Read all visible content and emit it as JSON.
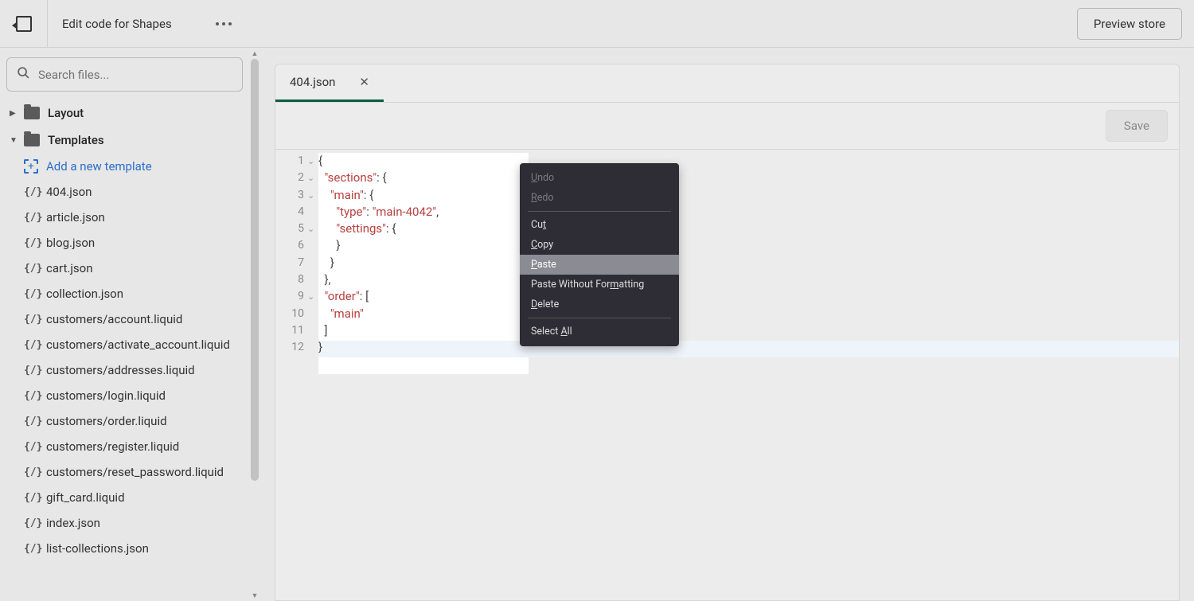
{
  "header": {
    "title": "Edit code for Shapes",
    "preview_label": "Preview store"
  },
  "search": {
    "placeholder": "Search files..."
  },
  "folders": {
    "layout": "Layout",
    "templates": "Templates"
  },
  "add_template": "Add a new template",
  "template_files": [
    "404.json",
    "article.json",
    "blog.json",
    "cart.json",
    "collection.json",
    "customers/account.liquid",
    "customers/activate_account.liquid",
    "customers/addresses.liquid",
    "customers/login.liquid",
    "customers/order.liquid",
    "customers/register.liquid",
    "customers/reset_password.liquid",
    "gift_card.liquid",
    "index.json",
    "list-collections.json"
  ],
  "tab": {
    "label": "404.json"
  },
  "toolbar": {
    "save_label": "Save"
  },
  "code": {
    "lines": [
      {
        "n": "1",
        "fold": "⌄",
        "pre": "",
        "str": "",
        "post": "{"
      },
      {
        "n": "2",
        "fold": "⌄",
        "pre": "  ",
        "str": "\"sections\"",
        "post": ": {"
      },
      {
        "n": "3",
        "fold": "⌄",
        "pre": "    ",
        "str": "\"main\"",
        "post": ": {"
      },
      {
        "n": "4",
        "fold": "",
        "pre": "      ",
        "str": "\"type\"",
        "mid": ": ",
        "str2": "\"main-4042\"",
        "post": ","
      },
      {
        "n": "5",
        "fold": "⌄",
        "pre": "      ",
        "str": "\"settings\"",
        "post": ": {"
      },
      {
        "n": "6",
        "fold": "",
        "pre": "      ",
        "str": "",
        "post": "}"
      },
      {
        "n": "7",
        "fold": "",
        "pre": "    ",
        "str": "",
        "post": "}"
      },
      {
        "n": "8",
        "fold": "",
        "pre": "  ",
        "str": "",
        "post": "},"
      },
      {
        "n": "9",
        "fold": "⌄",
        "pre": "  ",
        "str": "\"order\"",
        "post": ": ["
      },
      {
        "n": "10",
        "fold": "",
        "pre": "    ",
        "str": "\"main\"",
        "post": ""
      },
      {
        "n": "11",
        "fold": "",
        "pre": "  ",
        "str": "",
        "post": "]"
      },
      {
        "n": "12",
        "fold": "",
        "pre": "",
        "str": "",
        "post": "}"
      }
    ]
  },
  "context_menu": [
    {
      "key": "undo",
      "label_pre": "",
      "u": "U",
      "label_post": "ndo",
      "disabled": true
    },
    {
      "key": "redo",
      "label_pre": "",
      "u": "R",
      "label_post": "edo",
      "disabled": true
    },
    {
      "key": "sep"
    },
    {
      "key": "cut",
      "label_pre": "Cu",
      "u": "t",
      "label_post": "",
      "disabled": false
    },
    {
      "key": "copy",
      "label_pre": "",
      "u": "C",
      "label_post": "opy",
      "disabled": false
    },
    {
      "key": "paste",
      "label_pre": "",
      "u": "P",
      "label_post": "aste",
      "disabled": false,
      "hover": true
    },
    {
      "key": "pastewf",
      "label_pre": "Paste Without For",
      "u": "m",
      "label_post": "atting",
      "disabled": false
    },
    {
      "key": "delete",
      "label_pre": "",
      "u": "D",
      "label_post": "elete",
      "disabled": false
    },
    {
      "key": "sep"
    },
    {
      "key": "selectall",
      "label_pre": "Select ",
      "u": "A",
      "label_post": "ll",
      "disabled": false
    }
  ]
}
